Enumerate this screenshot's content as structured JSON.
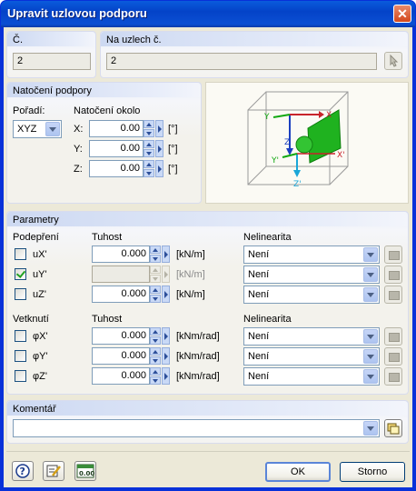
{
  "window": {
    "title": "Upravit uzlovou podporu",
    "close": "✕"
  },
  "no_group": {
    "label": "Č.",
    "value": "2"
  },
  "nodes_group": {
    "label": "Na uzlech č.",
    "value": "2"
  },
  "rotation_group": {
    "title": "Natočení podpory",
    "order_label": "Pořadí:",
    "order_value": "XYZ",
    "about_label": "Natočení okolo",
    "axes": [
      {
        "label": "X:",
        "value": "0.00",
        "unit": "[°]"
      },
      {
        "label": "Y:",
        "value": "0.00",
        "unit": "[°]"
      },
      {
        "label": "Z:",
        "value": "0.00",
        "unit": "[°]"
      }
    ]
  },
  "preview": {
    "labels": {
      "x": "X",
      "y": "Y",
      "z": "Z",
      "xp": "X'",
      "yp": "Y'",
      "zp": "Z'"
    }
  },
  "params": {
    "title": "Parametry",
    "support_header": "Podepření",
    "stiffness_header": "Tuhost",
    "nonlinearity_header": "Nelinearita",
    "supports": [
      {
        "label": "uX'",
        "checked": false,
        "value": "0.000",
        "unit": "[kN/m]",
        "nonlin": "Není",
        "enabled": true
      },
      {
        "label": "uY'",
        "checked": true,
        "value": "",
        "unit": "[kN/m]",
        "nonlin": "Není",
        "enabled": false
      },
      {
        "label": "uZ'",
        "checked": false,
        "value": "0.000",
        "unit": "[kN/m]",
        "nonlin": "Není",
        "enabled": true
      }
    ],
    "restraint_header": "Vetknutí",
    "restraints": [
      {
        "label": "φX'",
        "checked": false,
        "value": "0.000",
        "unit": "[kNm/rad]",
        "nonlin": "Není"
      },
      {
        "label": "φY'",
        "checked": false,
        "value": "0.000",
        "unit": "[kNm/rad]",
        "nonlin": "Není"
      },
      {
        "label": "φZ'",
        "checked": false,
        "value": "0.000",
        "unit": "[kNm/rad]",
        "nonlin": "Není"
      }
    ]
  },
  "comment": {
    "title": "Komentář",
    "value": ""
  },
  "footer": {
    "ok": "OK",
    "cancel": "Storno",
    "units_icon_text": "0.00"
  },
  "colors": {
    "title_bar": "#0a5bdc",
    "dialog_bg": "#ece9d8",
    "accent": "#316ac5"
  }
}
